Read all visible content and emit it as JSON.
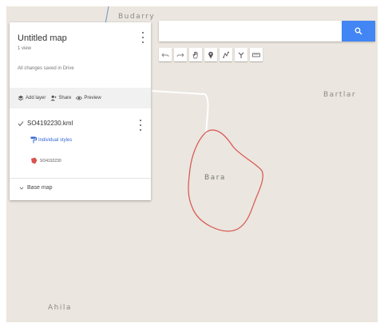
{
  "map": {
    "places": {
      "top": "Budarry",
      "bartlar": "Bartlar",
      "bara": "Bara",
      "ahila": "Ahila"
    },
    "colors": {
      "background": "#ebe6df",
      "road": "#ffffff",
      "boundary": "#d9534f",
      "accent": "#4285f4"
    }
  },
  "search": {
    "value": "",
    "placeholder": "",
    "button_icon": "search-icon"
  },
  "toolbar": {
    "tools": [
      "undo-icon",
      "redo-icon",
      "hand-icon",
      "marker-icon",
      "draw-line-icon",
      "route-icon",
      "ruler-icon"
    ]
  },
  "panel": {
    "title": "Untitled map",
    "views": "1 view",
    "saved_status": "All changes saved in Drive",
    "actions": {
      "add_layer": "Add layer",
      "share": "Share",
      "preview": "Preview"
    },
    "layer": {
      "name": "SO4192230.kml",
      "checked": true,
      "styles_label": "Individual styles",
      "feature_label": "SO4192230"
    },
    "base_map": "Base map"
  }
}
